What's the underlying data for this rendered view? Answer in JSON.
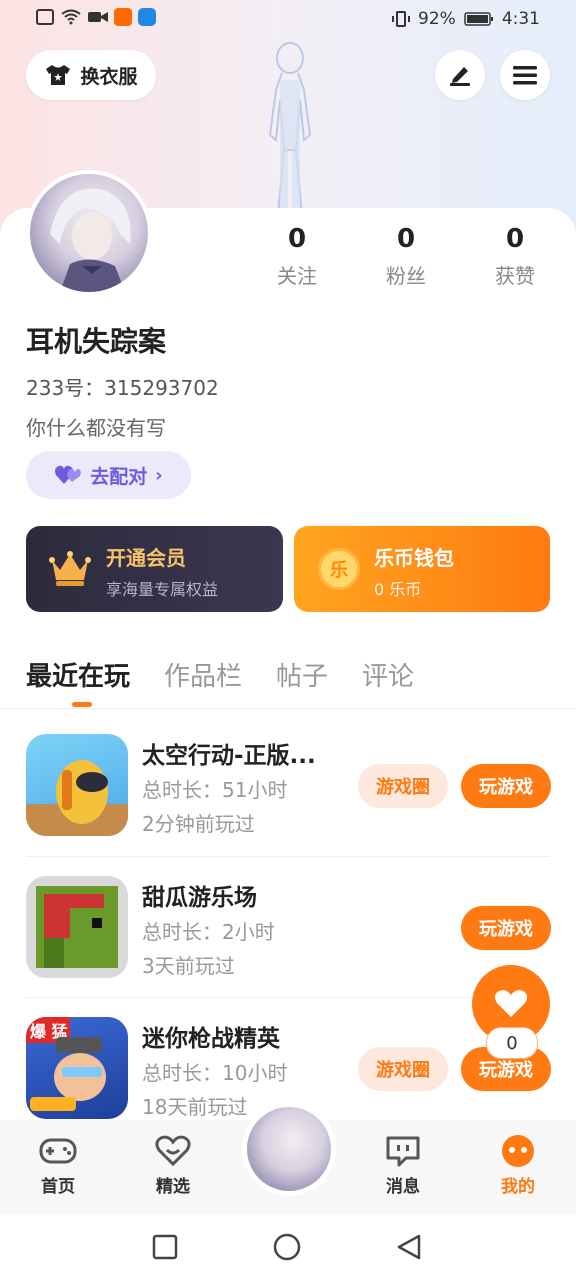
{
  "status_bar": {
    "battery": "92%",
    "time": "4:31"
  },
  "top": {
    "outfit_label": "换衣服"
  },
  "profile": {
    "name": "耳机失踪案",
    "id_line": "233号：315293702",
    "bio": "你什么都没有写",
    "match_label": "去配对",
    "stats": [
      {
        "value": "0",
        "label": "关注"
      },
      {
        "value": "0",
        "label": "粉丝"
      },
      {
        "value": "0",
        "label": "获赞"
      }
    ]
  },
  "vip_card": {
    "title": "开通会员",
    "subtitle": "享海量专属权益"
  },
  "wallet_card": {
    "title": "乐币钱包",
    "subtitle": "0 乐币",
    "coin_glyph": "乐"
  },
  "tabs": [
    "最近在玩",
    "作品栏",
    "帖子",
    "评论"
  ],
  "games": [
    {
      "title": "太空行动-正版...",
      "duration": "总时长：51小时",
      "last_played": "2分钟前玩过",
      "circle_label": "游戏圈",
      "play_label": "玩游戏"
    },
    {
      "title": "甜瓜游乐场",
      "duration": "总时长：2小时",
      "last_played": "3天前玩过",
      "play_label": "玩游戏"
    },
    {
      "title": "迷你枪战精英",
      "duration": "总时长：10小时",
      "last_played": "18天前玩过",
      "circle_label": "游戏圈",
      "play_label": "玩游戏",
      "icon_badge": "爆 猛"
    }
  ],
  "like": {
    "count": "0"
  },
  "bottom_nav": [
    "首页",
    "精选",
    "消息",
    "我的"
  ],
  "colors": {
    "accent": "#ff7a12",
    "purple": "#6c5ce0"
  }
}
